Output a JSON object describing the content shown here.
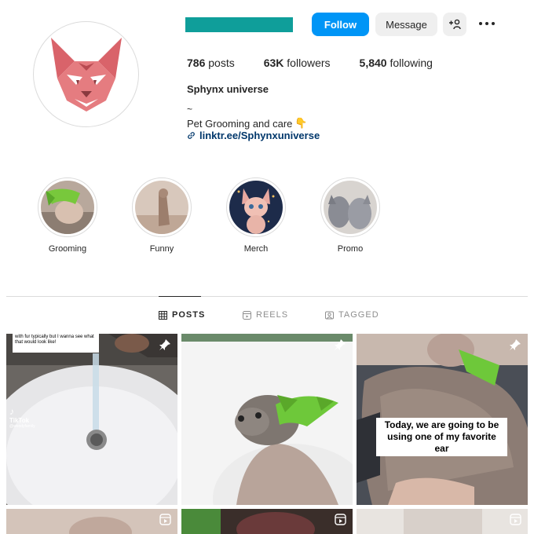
{
  "profile": {
    "actions": {
      "follow": "Follow",
      "message": "Message"
    },
    "stats": {
      "posts_value": "786",
      "posts_label": "posts",
      "followers_value": "63K",
      "followers_label": "followers",
      "following_value": "5,840",
      "following_label": "following"
    },
    "full_name": "Sphynx universe",
    "bio_line1": "~",
    "bio_line2": "Pet Grooming and care",
    "bio_emoji": "👇",
    "link": "linktr.ee/Sphynxuniverse"
  },
  "highlights": [
    {
      "label": "Grooming"
    },
    {
      "label": "Funny"
    },
    {
      "label": "Merch"
    },
    {
      "label": "Promo"
    }
  ],
  "tabs": [
    {
      "label": "POSTS",
      "icon": "grid-icon"
    },
    {
      "label": "REELS",
      "icon": "reels-icon"
    },
    {
      "label": "TAGGED",
      "icon": "tagged-icon"
    }
  ],
  "posts": [
    {
      "caption_top": "with fur typically but I wanna see what that would look like!",
      "watermark": "TikTok",
      "watermark_user": "@woodyfamily",
      "badge": "pin-icon"
    },
    {
      "badge": "pin-icon"
    },
    {
      "caption": "Today, we are going to be using one of my favorite ear",
      "badge": "pin-icon"
    }
  ],
  "colors": {
    "accent": "#0095f6",
    "username_redaction": "#0f9e9a"
  }
}
